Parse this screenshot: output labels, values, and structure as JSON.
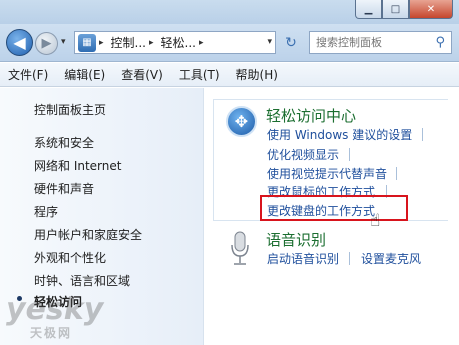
{
  "watermark": {
    "logo": "yesky",
    "site": "天极网"
  },
  "window": {
    "controls": {
      "minimize": "▁",
      "maximize": "□",
      "close": "✕"
    }
  },
  "nav": {
    "back": "◀",
    "forward": "▶",
    "dropdown": "▾",
    "breadcrumbs": [
      "控制...",
      "轻松..."
    ],
    "crumb_sep": "▸",
    "refresh": "↻",
    "search_placeholder": "搜索控制面板"
  },
  "menu": [
    "文件(F)",
    "编辑(E)",
    "查看(V)",
    "工具(T)",
    "帮助(H)"
  ],
  "sidebar": {
    "items": [
      "控制面板主页",
      "系统和安全",
      "网络和 Internet",
      "硬件和声音",
      "程序",
      "用户帐户和家庭安全",
      "外观和个性化",
      "时钟、语言和区域",
      "轻松访问"
    ],
    "selected_index": 8
  },
  "ease_of_access": {
    "title": "轻松访问中心",
    "links": [
      "使用 Windows 建议的设置",
      "优化视频显示",
      "使用视觉提示代替声音",
      "更改鼠标的工作方式",
      "更改键盘的工作方式"
    ],
    "highlighted_link_index": 4
  },
  "speech": {
    "title": "语音识别",
    "links": [
      "启动语音识别",
      "设置麦克风"
    ]
  },
  "colors": {
    "link": "#1f4f9c",
    "group_title": "#1b6e30",
    "highlight_border": "#d8141d"
  }
}
